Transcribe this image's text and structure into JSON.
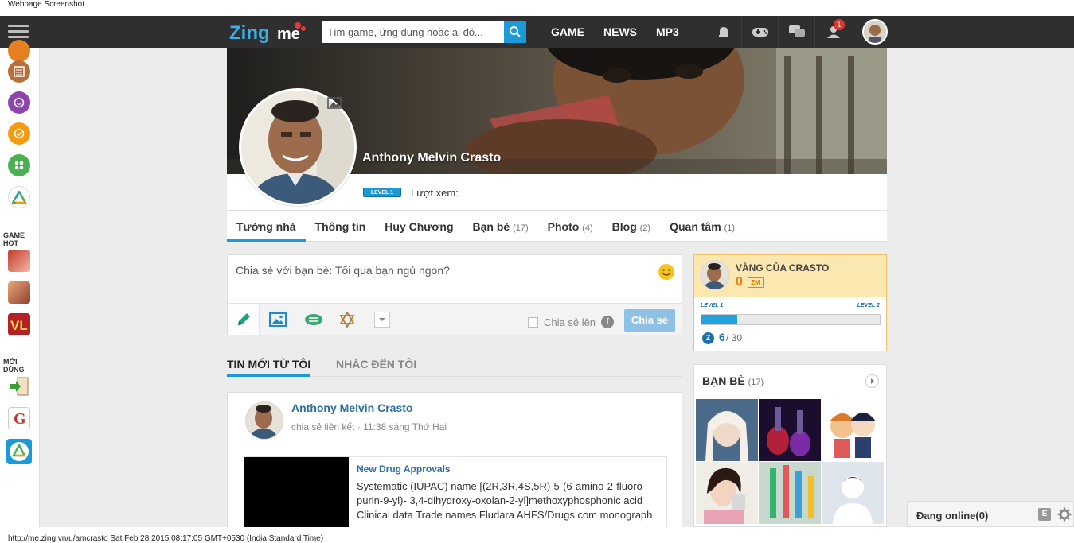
{
  "capture_label": "Webpage Screenshot",
  "status_url": "http://me.zing.vn/u/amcrasto Sat Feb 28 2015 08:17:05 GMT+0530 (India Standard Time)",
  "header": {
    "logo_text_1": "Zing",
    "logo_text_2": "me",
    "search_placeholder": "Tìm game, ứng dụng hoặc ai đó...",
    "nav": [
      "GAME",
      "NEWS",
      "MP3"
    ],
    "notification_count": "1"
  },
  "sidebar": {
    "game_hot_label": "GAME HOT",
    "new_used_label": "MỚI DÙNG",
    "app_icon_colors": [
      "#b5703c",
      "#8e44ad",
      "#f39c12",
      "#4caf50"
    ]
  },
  "profile": {
    "name": "Anthony Melvin Crasto",
    "level_badge": "LEVEL 1",
    "views_label": "Lượt xem:"
  },
  "tabs": [
    {
      "label": "Tường nhà",
      "count": ""
    },
    {
      "label": "Thông tin",
      "count": ""
    },
    {
      "label": "Huy Chương",
      "count": ""
    },
    {
      "label": "Bạn bè",
      "count": "(17)"
    },
    {
      "label": "Photo",
      "count": "(4)"
    },
    {
      "label": "Blog",
      "count": "(2)"
    },
    {
      "label": "Quan tâm",
      "count": "(1)"
    }
  ],
  "composer": {
    "prompt": "Chia sẻ với bạn bè:  Tối qua bạn ngủ ngon?",
    "share_to_label": "Chia sẻ lên",
    "share_button": "Chia sẻ"
  },
  "feed_tabs": [
    "TIN MỚI TỪ TÔI",
    "NHẮC ĐẾN TÔI"
  ],
  "post": {
    "author": "Anthony Melvin Crasto",
    "action": "chia sẻ liên kết",
    "time": "11:38 sáng Thứ Hai",
    "link_title": "New Drug Approvals",
    "link_desc": "Systematic (IUPAC) name [(2R,3R,4S,5R)-5-(6-amino-2-fluoro-purin-9-yl)- 3,4-dihydroxy-oxolan-2-yl]methoxyphosphonic acid Clinical data Trade names Fludara AHFS/Drugs.com monograph"
  },
  "gold": {
    "title": "VÀNG CỦA CRASTO",
    "amount": "0",
    "currency": "ZM",
    "level_left": "LEVEL 1",
    "level_right": "LEVEL 2",
    "progress_fraction": 0.2,
    "xp_current": "6",
    "xp_max": "/ 30"
  },
  "friends": {
    "title": "BẠN BÈ",
    "count": "(17)"
  },
  "online": {
    "label": "Đang online(0)",
    "e_button": "E"
  },
  "colors": {
    "accent": "#1d9ad6",
    "topbar": "#2f2f2f",
    "link": "#2a6ea6",
    "gold": "#f07a12"
  }
}
